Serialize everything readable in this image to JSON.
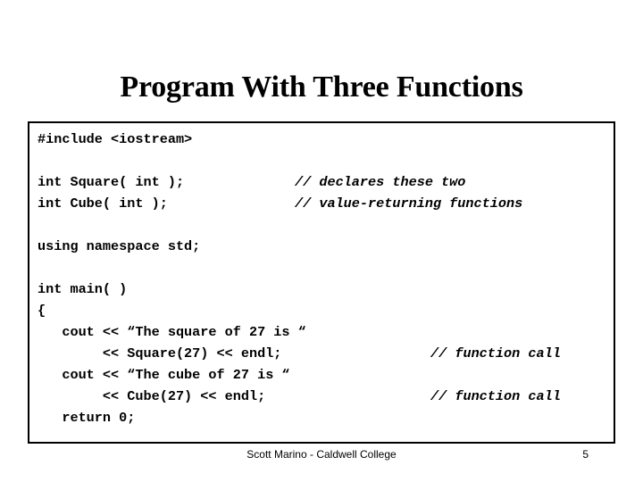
{
  "slide": {
    "title": "Program With Three Functions",
    "background_color": "#ffffff",
    "text_color": "#000000"
  },
  "code_box": {
    "border_color": "#000000",
    "lines": [
      {
        "text": "#include <iostream>",
        "comment": ""
      },
      {
        "text": "",
        "comment": ""
      },
      {
        "text": "int Square( int );",
        "comment": "// declares these two",
        "comment_col": "a"
      },
      {
        "text": "int Cube( int );",
        "comment": "// value-returning functions",
        "comment_col": "a"
      },
      {
        "text": "",
        "comment": ""
      },
      {
        "text": "using namespace std;",
        "comment": ""
      },
      {
        "text": "",
        "comment": ""
      },
      {
        "text": "int main( )",
        "comment": ""
      },
      {
        "text": "{",
        "comment": ""
      },
      {
        "text": "   cout << “The square of 27 is “",
        "comment": ""
      },
      {
        "text": "        << Square(27) << endl;",
        "comment": "// function call",
        "comment_col": "b"
      },
      {
        "text": "   cout << “The cube of 27 is “",
        "comment": ""
      },
      {
        "text": "        << Cube(27) << endl;",
        "comment": "// function call",
        "comment_col": "b"
      },
      {
        "text": "   return 0;",
        "comment": ""
      },
      {
        "text": "",
        "comment": ""
      },
      {
        "text": "}",
        "comment": ""
      }
    ]
  },
  "footer": {
    "note": "Scott Marino - Caldwell College",
    "page_number": "5"
  }
}
